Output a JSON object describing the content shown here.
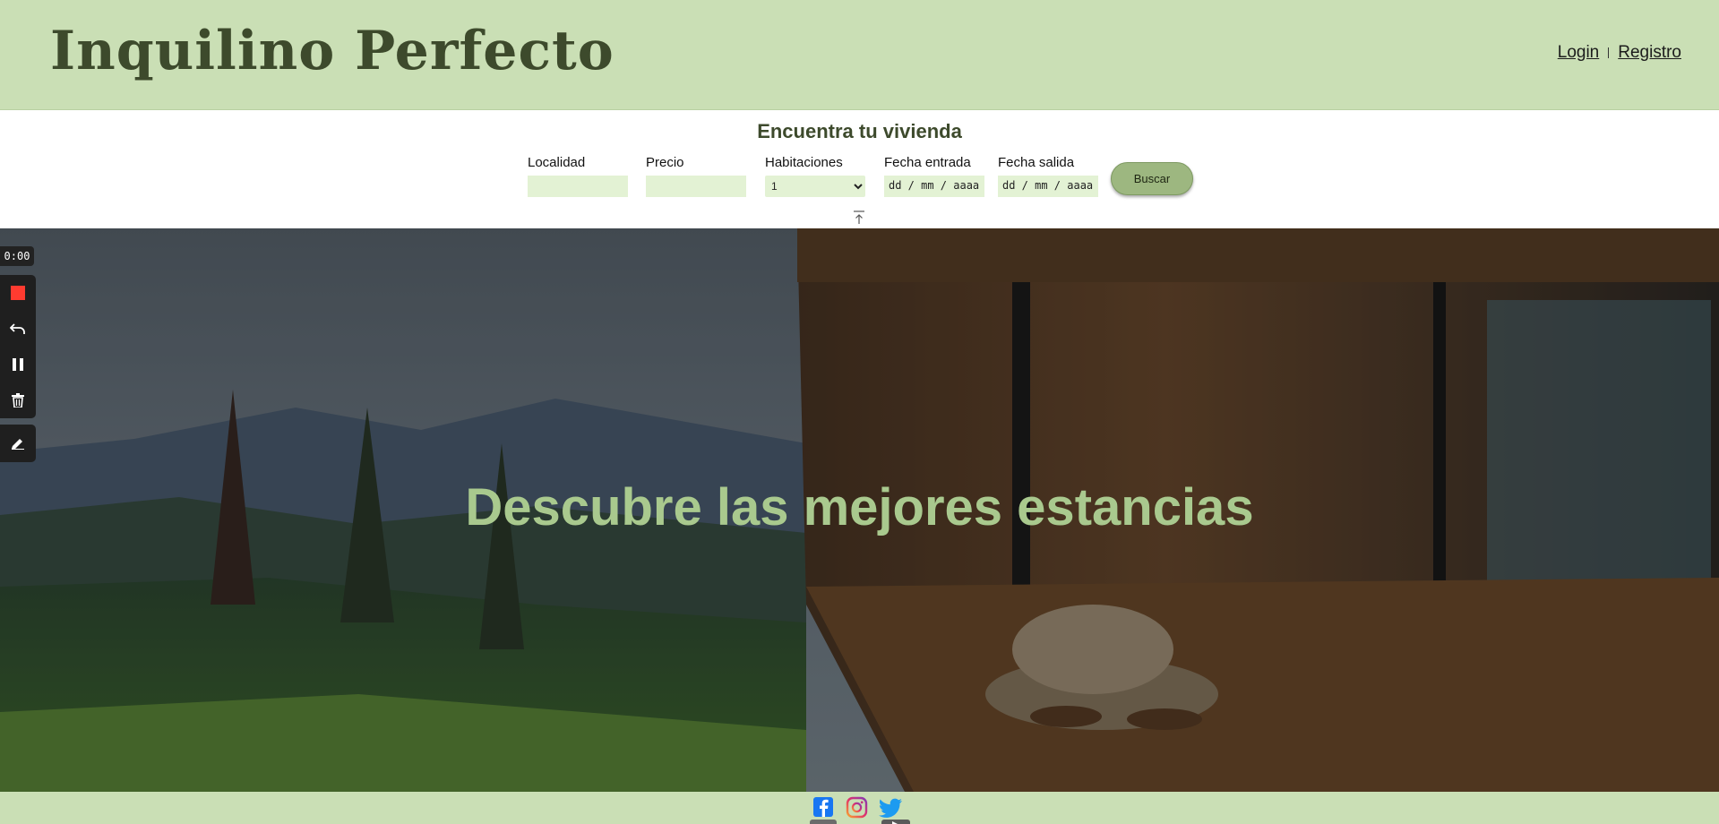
{
  "header": {
    "brand": "Inquilino Perfecto",
    "login": "Login",
    "register": "Registro"
  },
  "search": {
    "title": "Encuentra tu vivienda",
    "locality_label": "Localidad",
    "price_label": "Precio",
    "rooms_label": "Habitaciones",
    "rooms_value": "1",
    "checkin_label": "Fecha entrada",
    "checkin_value": "dd / mm / aaaa",
    "checkout_label": "Fecha salida",
    "checkout_value": "dd / mm / aaaa",
    "button": "Buscar"
  },
  "hero": {
    "title": "Descubre las mejores estancias"
  },
  "recorder": {
    "time": "0:00"
  },
  "footer": {
    "social": [
      "facebook-icon",
      "instagram-icon",
      "twitter-icon"
    ]
  },
  "colors": {
    "header_bg": "#cadfb5",
    "brand_text": "#3d4a2c",
    "field_bg": "#e3f2d4",
    "button_bg": "#9db780",
    "hero_title": "#a9c98e"
  }
}
